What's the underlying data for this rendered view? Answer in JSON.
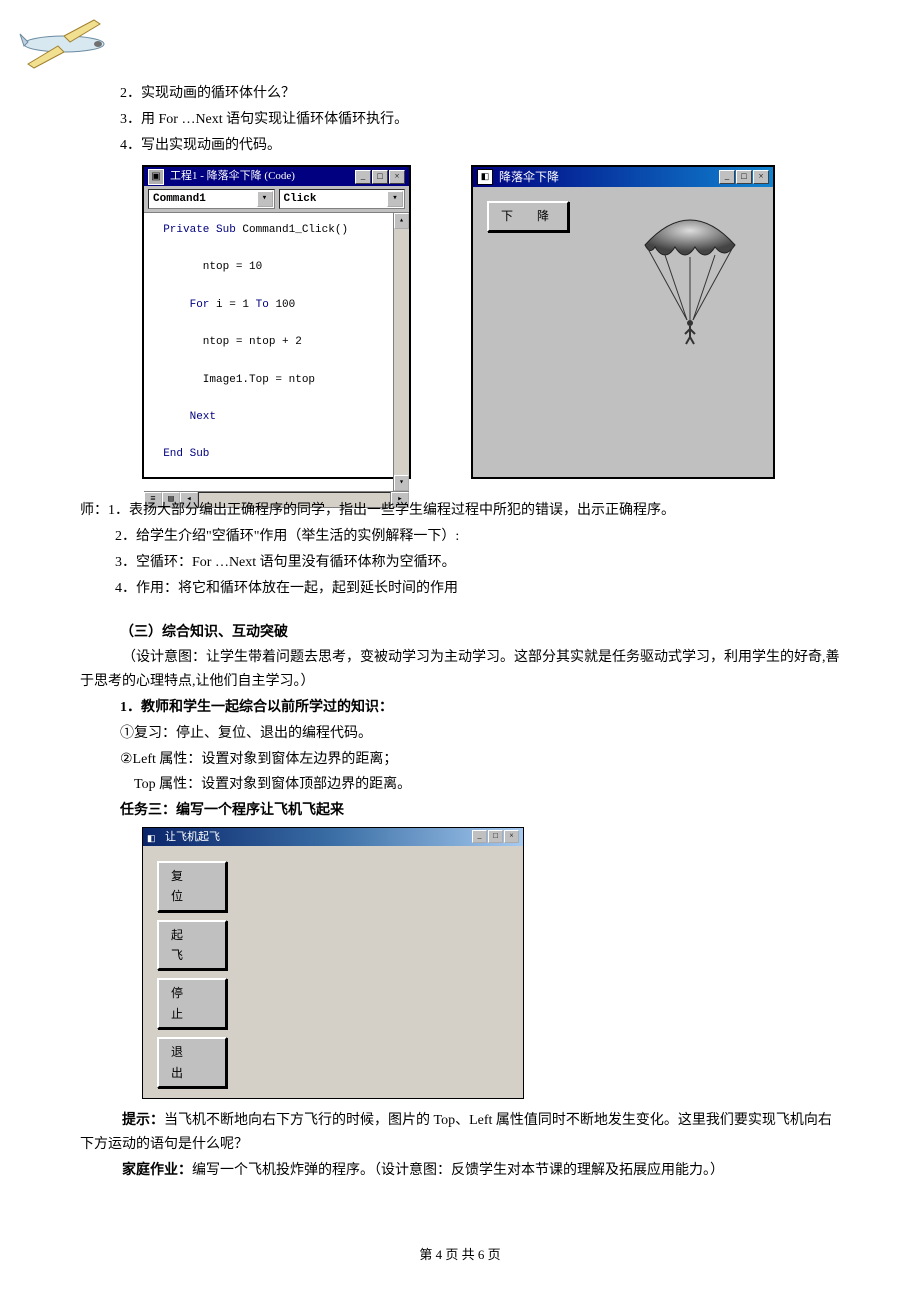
{
  "intro_lines": [
    "2．实现动画的循环体什么？",
    "3．用 For …Next 语句实现让循环体循环执行。",
    "4．写出实现动画的代码。"
  ],
  "code_window": {
    "title": "工程1 - 降落伞下降 (Code)",
    "dropdown_object": "Command1",
    "dropdown_event": "Click",
    "code_lines": [
      {
        "indent": 0,
        "kw": true,
        "text": "Private Sub ",
        "rest": "Command1_Click()"
      },
      {
        "indent": 2,
        "kw": false,
        "text": "ntop = 10"
      },
      {
        "indent": 1,
        "kw": true,
        "text": "For ",
        "rest": "i = 1 ",
        "kw2": "To ",
        "rest2": "100"
      },
      {
        "indent": 2,
        "kw": false,
        "text": "ntop = ntop + 2"
      },
      {
        "indent": 2,
        "kw": false,
        "text": "Image1.Top = ntop"
      },
      {
        "indent": 1,
        "kw": true,
        "text": "Next"
      },
      {
        "indent": 0,
        "kw": true,
        "text": "End Sub"
      }
    ]
  },
  "parachute_window": {
    "title": "降落伞下降",
    "button": "下　降"
  },
  "teacher_block": {
    "lead": "师：",
    "lines": [
      "1．表扬大部分编出正确程序的同学，指出一些学生编程过程中所犯的错误，出示正确程序。",
      "2．给学生介绍\"空循环\"作用（举生活的实例解释一下）:",
      "3．空循环：For …Next 语句里没有循环体称为空循环。",
      "4．作用：将它和循环体放在一起，起到延长时间的作用"
    ]
  },
  "section3": {
    "heading": "（三）综合知识、互动突破",
    "design": "（设计意图：让学生带着问题去思考，变被动学习为主动学习。这部分其实就是任务驱动式学习，利用学生的好奇,善于思考的心理特点,让他们自主学习。）",
    "sub1_heading": "1．教师和学生一起综合以前所学过的知识：",
    "sub1_lines": [
      "①复习：停止、复位、退出的编程代码。",
      "②Left 属性：设置对象到窗体左边界的距离；",
      "　Top 属性：设置对象到窗体顶部边界的距离。"
    ],
    "task3_heading": "任务三：编写一个程序让飞机飞起来"
  },
  "plane_window": {
    "title": "让飞机起飞",
    "buttons": [
      "复　位",
      "起　飞",
      "停　止",
      "退　出"
    ]
  },
  "hint": {
    "label": "提示：",
    "text": "当飞机不断地向右下方飞行的时候，图片的 Top、Left 属性值同时不断地发生变化。这里我们要实现飞机向右下方运动的语句是什么呢？"
  },
  "homework": {
    "label": "家庭作业：",
    "text": "编写一个飞机投炸弹的程序。（设计意图：反馈学生对本节课的理解及拓展应用能力。）"
  },
  "footer": "第 4 页 共 6 页"
}
